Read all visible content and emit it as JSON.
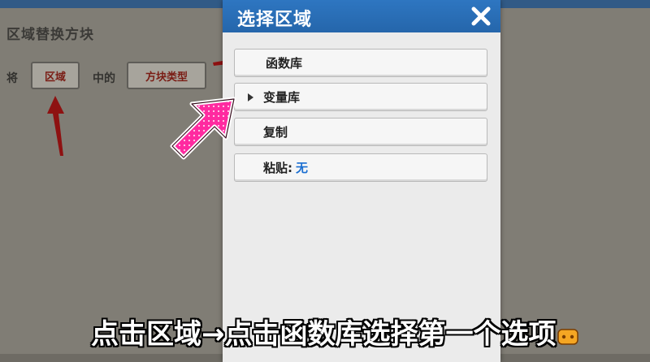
{
  "background": {
    "section_title": "区域替换方块",
    "rule_prefix": "将",
    "region_button": "区域",
    "rule_middle": "中的",
    "block_type_button": "方块类型"
  },
  "modal": {
    "title": "选择区域",
    "items": [
      {
        "label": "函数库"
      },
      {
        "label": "变量库"
      },
      {
        "label": "复制"
      },
      {
        "label": "粘贴:"
      }
    ],
    "paste_value": "无"
  },
  "subtitle": "点击区域→点击函数库选择第一个选项",
  "colors": {
    "header": "#2a6fb8",
    "arrow_red": "#8e1111",
    "pointer_pink": "#ff2aa0",
    "paste_value": "#1b6fd1"
  }
}
